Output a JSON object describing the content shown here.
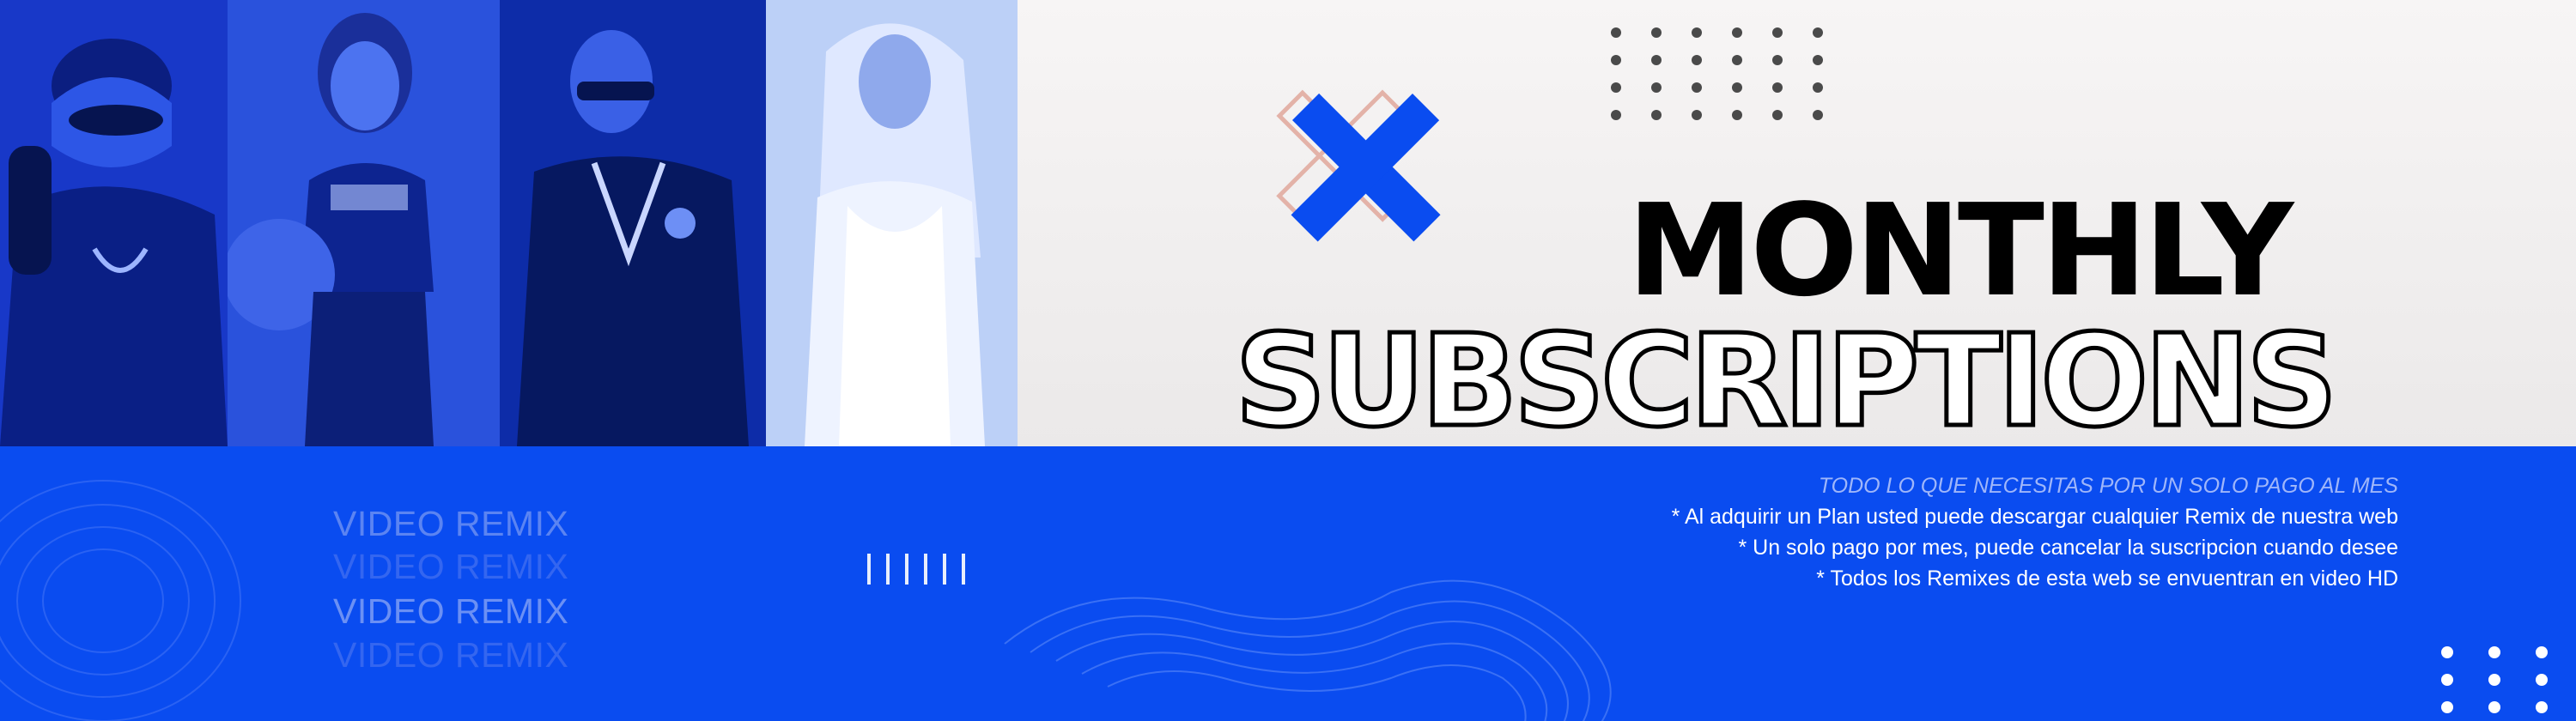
{
  "banner": {
    "title_line1": "MONTHLY",
    "title_line2": "SUBSCRIPTIONS",
    "remix_label": "VIDEO REMIX",
    "remix_rows": [
      "VIDEO REMIX",
      "VIDEO REMIX",
      "VIDEO REMIX",
      "VIDEO REMIX"
    ],
    "info_heading": "TODO LO QUE NECESITAS POR UN SOLO PAGO AL MES",
    "info_lines": [
      "* Al adquirir un Plan usted puede descargar cualquier Remix de nuestra web",
      "* Un solo pago por mes, puede cancelar la suscripcion cuando desee",
      "* Todos los Remixes de esta web se envuentran en video HD"
    ],
    "accent_color": "#0a4cf0",
    "x_icon": "x-icon"
  }
}
